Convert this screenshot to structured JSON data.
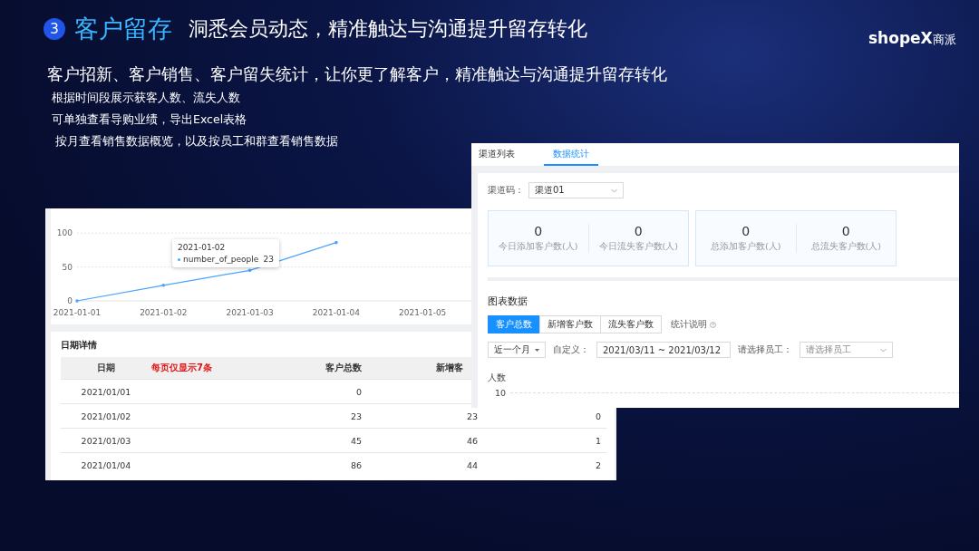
{
  "header": {
    "number": "3",
    "title": "客户留存",
    "subtitle": "洞悉会员动态，精准触达与沟通提升留存转化"
  },
  "logo": {
    "text": "shopeX",
    "suffix": "商派"
  },
  "intro": "客户招新、客户销售、客户留失统计，让你更了解客户，精准触达与沟通提升留存转化",
  "bullets": [
    "根据时间段展示获客人数、流失人数",
    "可单独查看导购业绩，导出Excel表格",
    "按月查看销售数据概览，以及按员工和群查看销售数据"
  ],
  "trend_screen": {
    "chart_data": {
      "type": "line",
      "categories": [
        "2021-01-01",
        "2021-01-02",
        "2021-01-03",
        "2021-01-04",
        "2021-01-05"
      ],
      "yticks": [
        0,
        50,
        100
      ],
      "ylim": [
        0,
        135
      ],
      "series": [
        {
          "name": "number_of_people",
          "color": "#4aa3ff",
          "values": [
            0,
            23,
            45,
            86,
            null
          ]
        }
      ]
    },
    "tooltip": {
      "date": "2021-01-02",
      "value": "23"
    },
    "table": {
      "title": "日期详情",
      "columns": [
        {
          "label": "日期",
          "kind": "normal"
        },
        {
          "label": "每页仅显示7条",
          "kind": "note"
        },
        {
          "label": "客户总数",
          "kind": "normal"
        },
        {
          "label": "新增客",
          "kind": "normal"
        }
      ],
      "rows": [
        {
          "date": "2021/01/01",
          "total": "0"
        },
        {
          "date": "2021/01/02",
          "total": "23",
          "new": "23",
          "column_5": "0"
        },
        {
          "date": "2021/01/03",
          "total": "45",
          "new": "46",
          "column_5": "1"
        },
        {
          "date": "2021/01/04",
          "total": "86",
          "new": "44",
          "column_5": "2"
        }
      ]
    }
  },
  "stats_screen": {
    "tabs": [
      {
        "label": "渠道列表",
        "selected": false
      },
      {
        "label": "数据统计",
        "selected": true
      }
    ],
    "channel_filter": {
      "label": "渠道码：",
      "value": "渠道01"
    },
    "stat_groups": [
      [
        {
          "value": "0",
          "label": "今日添加客户数(人)"
        },
        {
          "value": "0",
          "label": "今日流失客户数(人)"
        }
      ],
      [
        {
          "value": "0",
          "label": "总添加客户数(人)"
        },
        {
          "value": "0",
          "label": "总流失客户数(人)"
        }
      ]
    ],
    "section_title": "图表数据",
    "modes": [
      {
        "label": "客户总数",
        "selected": true
      },
      {
        "label": "新增客户数",
        "selected": false
      },
      {
        "label": "流失客户数",
        "selected": false
      }
    ],
    "help": "统计说明",
    "period": "近一个月",
    "custom": {
      "label": "自定义：",
      "value": "2021/03/11 ~ 2021/03/12"
    },
    "staff": {
      "label": "请选择员工：",
      "placeholder": "请选择员工"
    },
    "chart": {
      "ylabel": "人数",
      "tick": "10"
    }
  }
}
